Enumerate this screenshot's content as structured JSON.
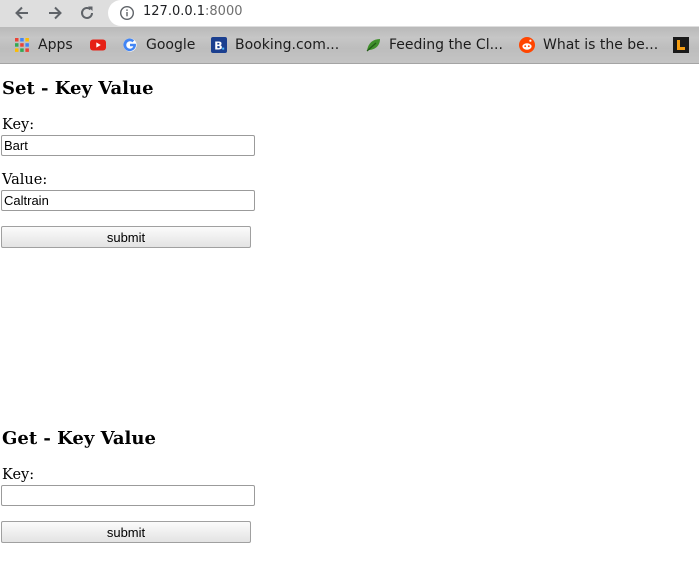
{
  "browser": {
    "url_host": "127.0.0.1",
    "url_port": ":8000",
    "bookmarks": [
      {
        "label": "Apps",
        "icon": "apps-grid-icon"
      },
      {
        "label": "",
        "icon": "youtube-icon"
      },
      {
        "label": "Google",
        "icon": "google-icon"
      },
      {
        "label": "Booking.com...",
        "icon": "booking-icon"
      },
      {
        "label": "Feeding the Cl...",
        "icon": "leaf-icon"
      },
      {
        "label": "What is the be...",
        "icon": "reddit-icon"
      },
      {
        "label": "",
        "icon": "bookmark-l-icon"
      }
    ]
  },
  "set_section": {
    "title": "Set - Key Value",
    "key_label": "Key:",
    "key_value": "Bart",
    "value_label": "Value:",
    "value_value": "Caltrain",
    "submit_label": "submit"
  },
  "get_section": {
    "title": "Get - Key Value",
    "key_label": "Key:",
    "key_value": "",
    "submit_label": "submit"
  }
}
